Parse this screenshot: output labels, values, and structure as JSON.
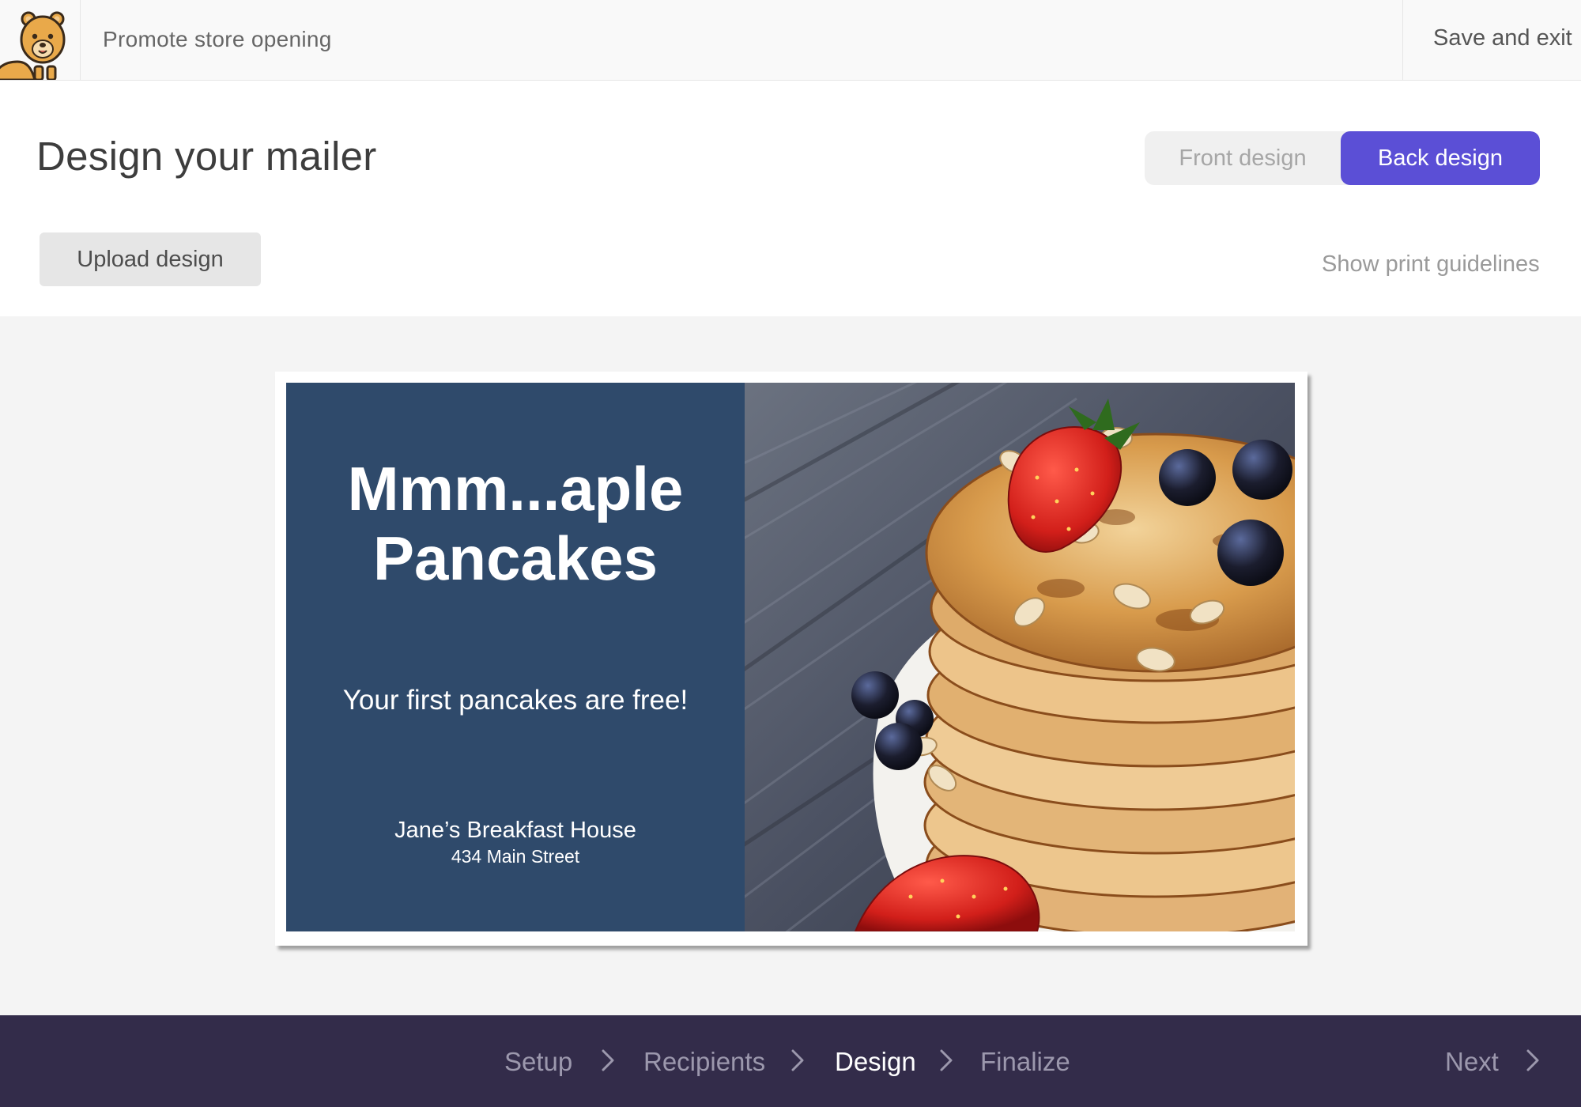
{
  "topbar": {
    "campaign_title": "Promote store opening",
    "save_exit_label": "Save and exit",
    "logo_icon": "bear-mascot-icon"
  },
  "header": {
    "title": "Design your mailer",
    "toggle": {
      "front_label": "Front design",
      "back_label": "Back design",
      "selected": "Back design"
    },
    "upload_label": "Upload design",
    "guidelines_label": "Show print guidelines"
  },
  "mailer": {
    "headline_line1": "Mmm...aple",
    "headline_line2": "Pancakes",
    "offer": "Your first pancakes are free!",
    "business_name": "Jane’s Breakfast House",
    "address": "434 Main Street",
    "panel_color": "#2f4a6b",
    "photo_subject": "stack of pancakes with strawberries, blueberries and peanuts"
  },
  "bottom_nav": {
    "steps": [
      "Setup",
      "Recipients",
      "Design",
      "Finalize"
    ],
    "current_step": "Design",
    "next_label": "Next"
  },
  "colors": {
    "accent": "#5b4fd6",
    "nav_background": "#332c4a"
  }
}
